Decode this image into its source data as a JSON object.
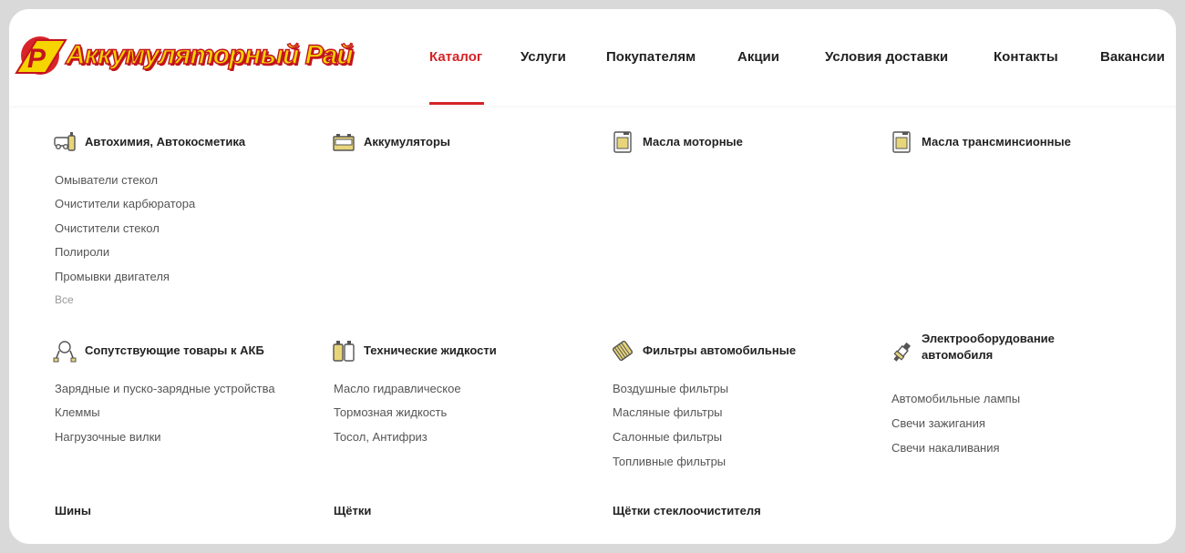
{
  "header": {
    "logo_text": "Аккумуляторный Рай",
    "nav": [
      {
        "label": "Каталог",
        "active": true
      },
      {
        "label": "Услуги"
      },
      {
        "label": "Покупателям"
      },
      {
        "label": "Акции"
      },
      {
        "label": "Условия доставки"
      },
      {
        "label": "Контакты"
      },
      {
        "label": "Вакансии"
      }
    ]
  },
  "catalog": {
    "row1": [
      {
        "title": "Автохимия, Автокосметика",
        "icon": "car-chemicals-icon",
        "items": [
          "Омыватели стекол",
          "Очистители карбюратора",
          "Очистители стекол",
          "Полироли",
          "Промывки двигателя"
        ],
        "all_label": "Все"
      },
      {
        "title": "Аккумуляторы",
        "icon": "battery-icon",
        "items": []
      },
      {
        "title": "Масла моторные",
        "icon": "oil-canister-icon",
        "items": []
      },
      {
        "title": "Масла трансминсионные",
        "icon": "oil-canister-icon",
        "items": []
      }
    ],
    "row2": [
      {
        "title": "Сопутствующие товары к АКБ",
        "icon": "charger-clamps-icon",
        "items": [
          "Зарядные и пуско-зарядные устройства",
          "Клеммы",
          "Нагрузочные вилки"
        ]
      },
      {
        "title": "Технические жидкости",
        "icon": "fluids-icon",
        "items": [
          "Масло гидравлическое",
          "Тормозная жидкость",
          "Тосол, Антифриз"
        ]
      },
      {
        "title": "Фильтры автомобильные",
        "icon": "filter-icon",
        "items": [
          "Воздушные фильтры",
          "Масляные фильтры",
          "Салонные фильтры",
          "Топливные фильтры"
        ]
      },
      {
        "title_line1": "Электрооборудование",
        "title_line2": "автомобиля",
        "icon": "spark-plug-icon",
        "items": [
          "Автомобильные лампы",
          "Свечи зажигания",
          "Свечи накаливания"
        ]
      }
    ],
    "row3": [
      "Шины",
      "Щётки",
      "Щётки стеклоочистителя"
    ]
  },
  "colors": {
    "accent": "#d42427",
    "logo_yellow": "#f5d400",
    "logo_red": "#c3141d",
    "background": "#d9d9d9"
  }
}
